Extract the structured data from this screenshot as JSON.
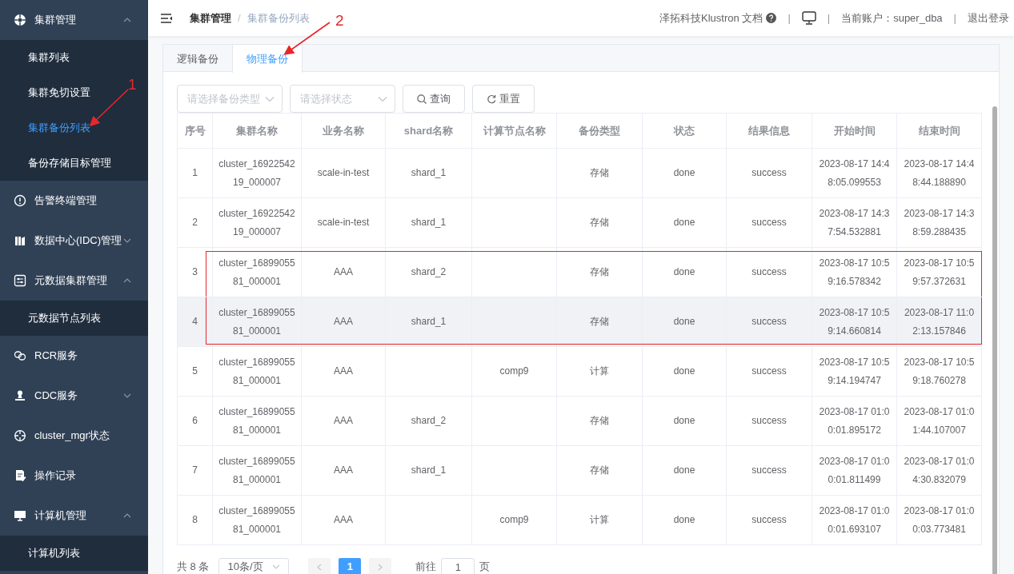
{
  "sidebar": {
    "items": [
      {
        "label": "集群管理",
        "expanded": true,
        "children": [
          {
            "label": "集群列表",
            "selected": false
          },
          {
            "label": "集群免切设置",
            "selected": false
          },
          {
            "label": "集群备份列表",
            "selected": true
          },
          {
            "label": "备份存储目标管理",
            "selected": false
          }
        ]
      },
      {
        "label": "告警终端管理"
      },
      {
        "label": "数据中心(IDC)管理",
        "expanded": false
      },
      {
        "label": "元数据集群管理",
        "expanded": true,
        "children": [
          {
            "label": "元数据节点列表",
            "selected": false
          }
        ]
      },
      {
        "label": "RCR服务"
      },
      {
        "label": "CDC服务",
        "expanded": false
      },
      {
        "label": "cluster_mgr状态"
      },
      {
        "label": "操作记录"
      },
      {
        "label": "计算机管理",
        "expanded": true,
        "children": [
          {
            "label": "计算机列表",
            "selected": false
          }
        ]
      }
    ]
  },
  "header": {
    "breadcrumb": [
      "集群管理",
      "集群备份列表"
    ],
    "breadcrumb_separator": "/",
    "docs_link": "泽拓科技Klustron 文档",
    "separator": "|",
    "account": "当前账户：super_dba",
    "logout": "退出登录"
  },
  "tabs": [
    {
      "label": "逻辑备份",
      "selected": false
    },
    {
      "label": "物理备份",
      "selected": true
    }
  ],
  "filters": {
    "backup_type": {
      "placeholder": "请选择备份类型"
    },
    "status": {
      "placeholder": "请选择状态"
    },
    "query_button": "查询",
    "reset_button": "重置"
  },
  "table": {
    "columns": [
      "序号",
      "集群名称",
      "业务名称",
      "shard名称",
      "计算节点名称",
      "备份类型",
      "状态",
      "结果信息",
      "开始时间",
      "结束时间"
    ],
    "rows": [
      {
        "cells": [
          "1",
          "cluster_1692254219_000007",
          "scale-in-test",
          "shard_1",
          "",
          "存储",
          "done",
          "success",
          "2023-08-17 14:48:05.099553",
          "2023-08-17 14:48:44.188890"
        ],
        "hovered": false,
        "outlined": false
      },
      {
        "cells": [
          "2",
          "cluster_1692254219_000007",
          "scale-in-test",
          "shard_1",
          "",
          "存储",
          "done",
          "success",
          "2023-08-17 14:37:54.532881",
          "2023-08-17 14:38:59.288435"
        ],
        "hovered": false,
        "outlined": false
      },
      {
        "cells": [
          "3",
          "cluster_1689905581_000001",
          "AAA",
          "shard_2",
          "",
          "存储",
          "done",
          "success",
          "2023-08-17 10:59:16.578342",
          "2023-08-17 10:59:57.372631"
        ],
        "hovered": false,
        "outlined": true
      },
      {
        "cells": [
          "4",
          "cluster_1689905581_000001",
          "AAA",
          "shard_1",
          "",
          "存储",
          "done",
          "success",
          "2023-08-17 10:59:14.660814",
          "2023-08-17 11:02:13.157846"
        ],
        "hovered": true,
        "outlined": true
      },
      {
        "cells": [
          "5",
          "cluster_1689905581_000001",
          "AAA",
          "",
          "comp9",
          "计算",
          "done",
          "success",
          "2023-08-17 10:59:14.194747",
          "2023-08-17 10:59:18.760278"
        ],
        "hovered": false,
        "outlined": false
      },
      {
        "cells": [
          "6",
          "cluster_1689905581_000001",
          "AAA",
          "shard_2",
          "",
          "存储",
          "done",
          "success",
          "2023-08-17 01:00:01.895172",
          "2023-08-17 01:01:44.107007"
        ],
        "hovered": false,
        "outlined": false
      },
      {
        "cells": [
          "7",
          "cluster_1689905581_000001",
          "AAA",
          "shard_1",
          "",
          "存储",
          "done",
          "success",
          "2023-08-17 01:00:01.811499",
          "2023-08-17 01:04:30.832079"
        ],
        "hovered": false,
        "outlined": false
      },
      {
        "cells": [
          "8",
          "cluster_1689905581_000001",
          "AAA",
          "",
          "comp9",
          "计算",
          "done",
          "success",
          "2023-08-17 01:00:01.693107",
          "2023-08-17 01:00:03.773481"
        ],
        "hovered": false,
        "outlined": false
      }
    ]
  },
  "pagination": {
    "total": "共 8 条",
    "page_size": "10条/页",
    "pages": [
      {
        "label": "1",
        "selected": true
      }
    ],
    "goto_label": "前往",
    "goto_value": "1",
    "goto_suffix": "页"
  },
  "annotations": [
    {
      "label": "1"
    },
    {
      "label": "2"
    }
  ]
}
